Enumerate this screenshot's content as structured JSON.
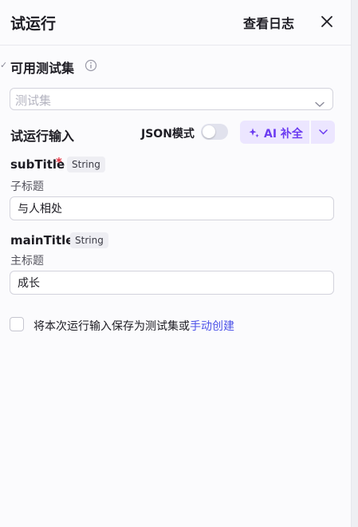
{
  "header": {
    "title": "试运行",
    "log_label": "查看日志"
  },
  "testset": {
    "title": "可用测试集",
    "placeholder": "测试集"
  },
  "run_input": {
    "title": "试运行输入",
    "json_mode_label": "JSON模式",
    "json_mode_on": false,
    "ai_fill_label": "AI 补全"
  },
  "fields": [
    {
      "name": "subTitle",
      "required": true,
      "type": "String",
      "desc": "子标题",
      "value": "与人相处"
    },
    {
      "name": "mainTitle",
      "required": false,
      "type": "String",
      "desc": "主标题",
      "value": "成长"
    }
  ],
  "save": {
    "text": "将本次运行输入保存为测试集或",
    "link": "手动创建",
    "checked": false
  },
  "colors": {
    "accent": "#6b3bf1",
    "link": "#4d53e8",
    "required": "#e53241",
    "ai_bg": "#ece6ff"
  },
  "icons": {
    "close": "close-icon",
    "info": "info-icon",
    "chevron": "chevron-down-icon",
    "sparkle": "sparkle-icon"
  }
}
